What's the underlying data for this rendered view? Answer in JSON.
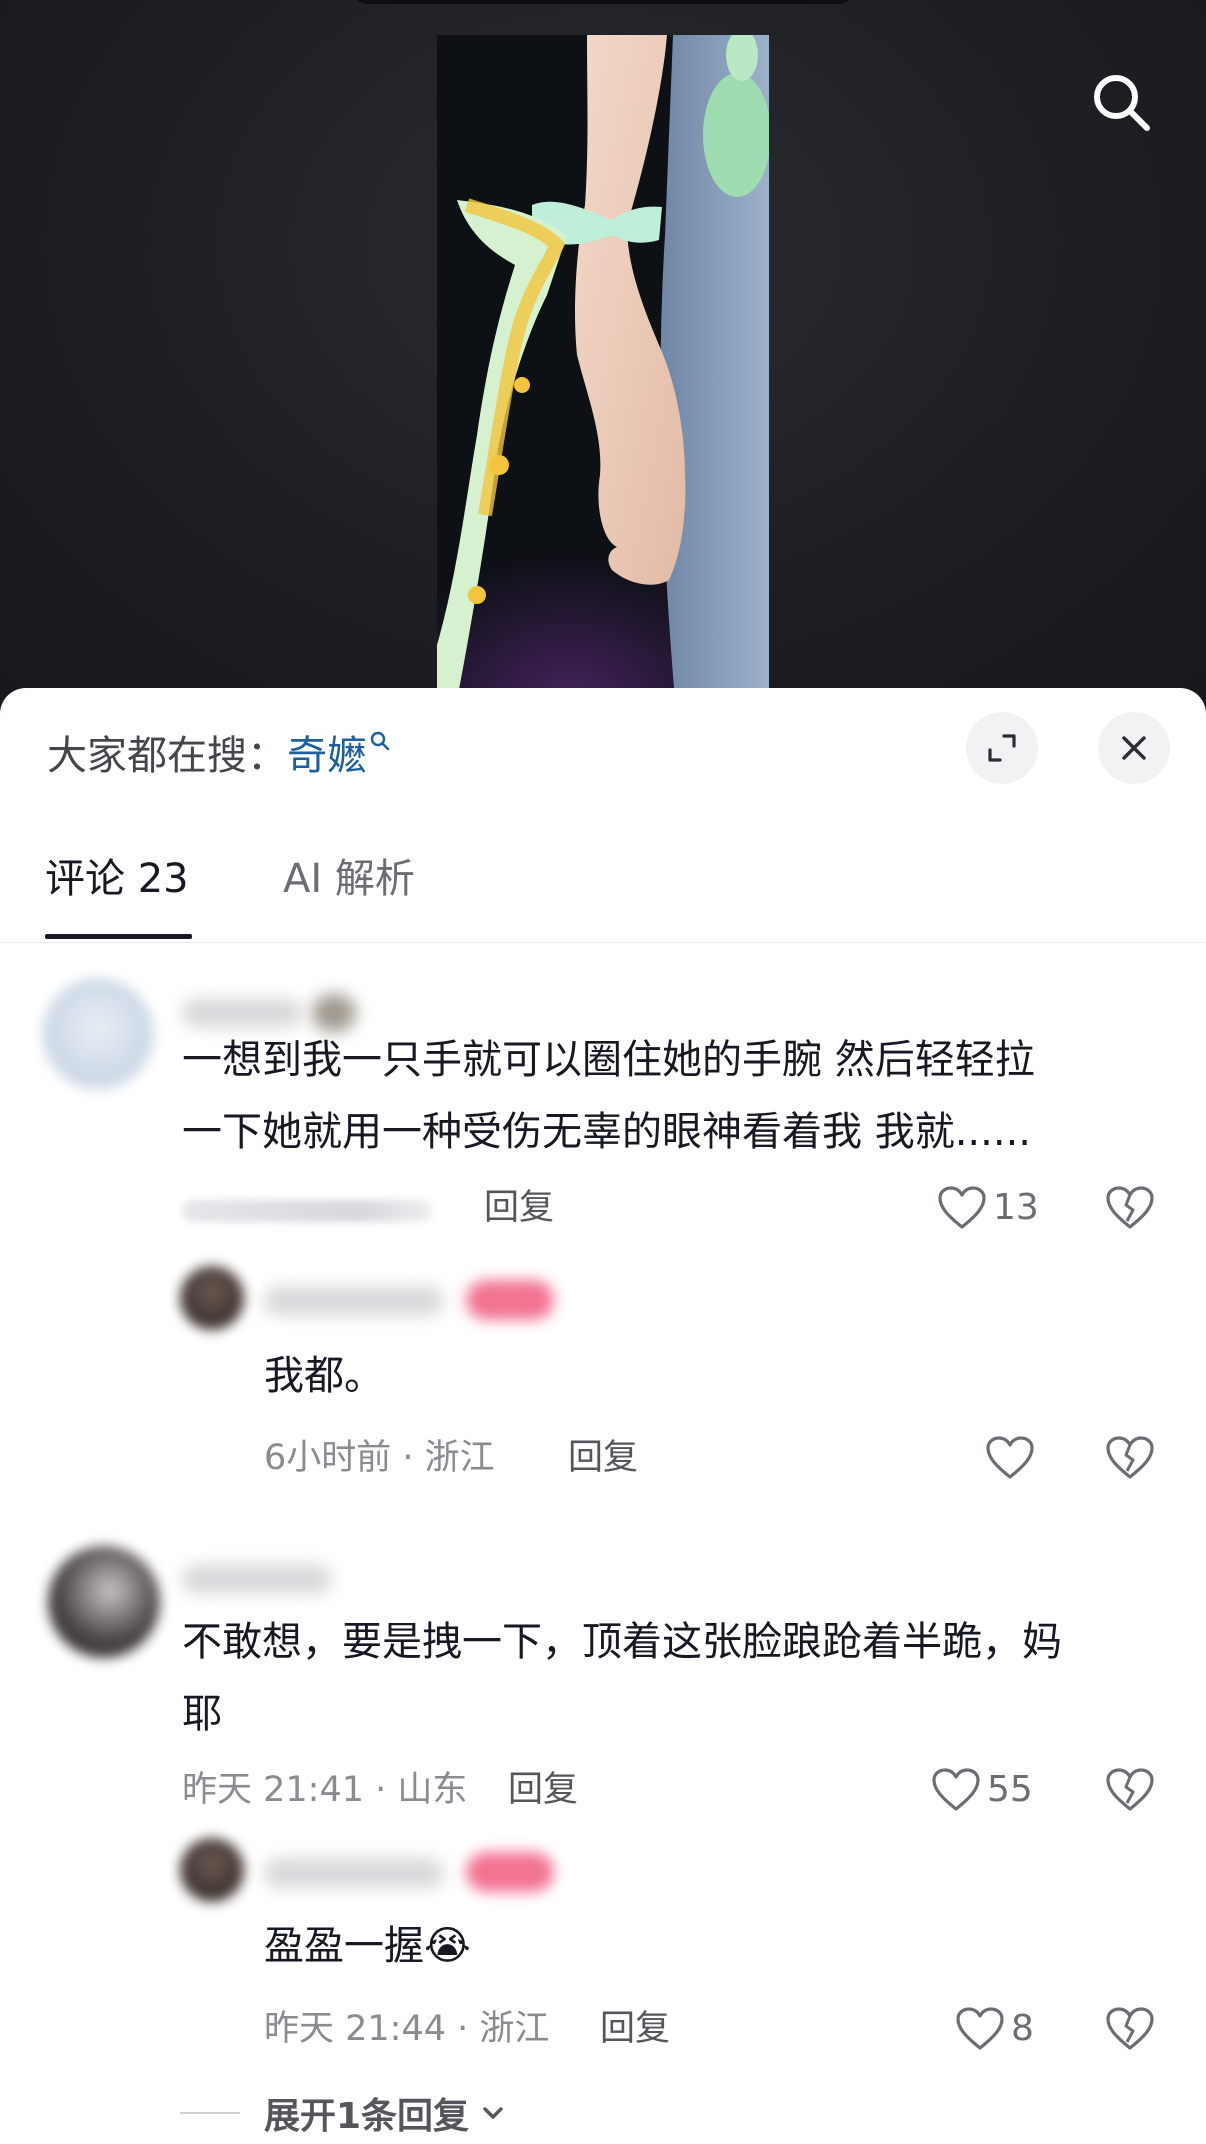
{
  "colors": {
    "keyword": "#1b5f9e",
    "text_primary": "#161823",
    "text_secondary": "#8a8b91",
    "sheet_bg": "#ffffff",
    "video_bg": "#1d1f23"
  },
  "icons": {
    "search": "search-icon",
    "expand": "expand-icon",
    "close": "close-icon",
    "like": "heart-outline-icon",
    "dislike": "broken-heart-icon",
    "chevron": "chevron-down-icon"
  },
  "header": {
    "search_prefix": "大家都在搜：",
    "search_keyword": "奇嬷"
  },
  "tabs": [
    {
      "label": "评论 23",
      "active": true
    },
    {
      "label": "AI 解析",
      "active": false
    }
  ],
  "comments": [
    {
      "lines": [
        "一想到我一只手就可以圈住她的手腕 然后轻轻拉",
        "一下她就用一种受伤无辜的眼神看着我 我就......"
      ],
      "reply_label": "回复",
      "likes": "13"
    },
    {
      "lines": [
        "我都。"
      ],
      "meta": "6小时前 · 浙江",
      "reply_label": "回复",
      "likes": ""
    },
    {
      "lines": [
        "不敢想，要是拽一下，顶着这张脸踉跄着半跪，妈",
        "耶"
      ],
      "meta": "昨天 21:41 · 山东",
      "reply_label": "回复",
      "likes": "55"
    },
    {
      "lines": [
        "盈盈一握"
      ],
      "emoji": "😭",
      "meta": "昨天 21:44 · 浙江",
      "reply_label": "回复",
      "likes": "8"
    }
  ],
  "expand_label": "展开1条回复"
}
